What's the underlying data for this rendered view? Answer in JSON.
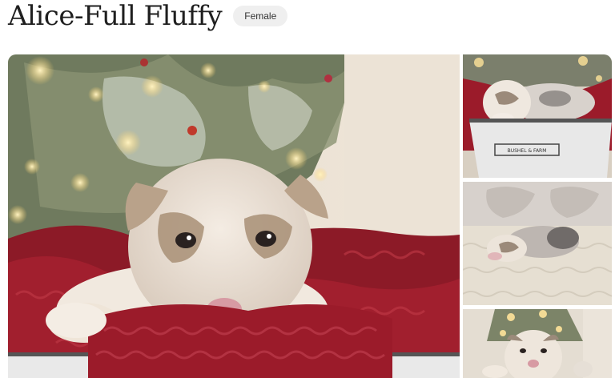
{
  "listing": {
    "title": "Alice-Full Fluffy",
    "gender_badge": "Female"
  },
  "gallery": {
    "main_photo": {
      "subject": "fluffy merle puppy on red knit blanket with christmas tree"
    },
    "thumbnails": [
      {
        "subject": "puppy lying in white metal tub with red blanket",
        "tub_label": "BUSHEL & FARM"
      },
      {
        "subject": "puppy lying on cream tufted cushion"
      },
      {
        "subject": "puppy held in front of christmas tree"
      }
    ]
  },
  "colors": {
    "blanket_red": "#9b1b2a",
    "badge_bg": "#efefef",
    "title_text": "#1f1f1f"
  }
}
